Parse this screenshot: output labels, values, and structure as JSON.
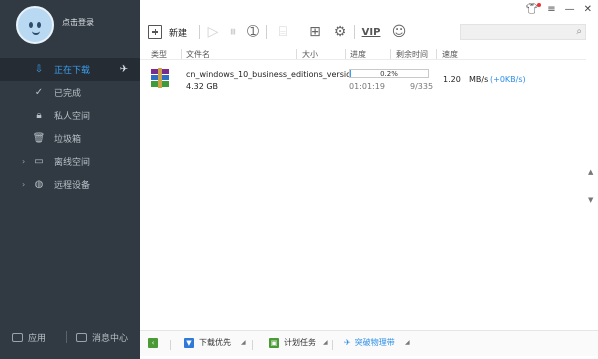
{
  "sidebar": {
    "login_text": "点击登录",
    "items": [
      {
        "label": "正在下载",
        "icon": "download-arrow-icon",
        "active": true
      },
      {
        "label": "已完成",
        "icon": "check-circle-icon"
      },
      {
        "label": "私人空间",
        "icon": "lock-icon"
      },
      {
        "label": "垃圾箱",
        "icon": "trash-icon"
      },
      {
        "label": "离线空间",
        "icon": "cloud-monitor-icon",
        "expandable": true
      },
      {
        "label": "远程设备",
        "icon": "globe-icon",
        "expandable": true
      }
    ],
    "app_label": "应用",
    "message_label": "消息中心"
  },
  "toolbar": {
    "new_label": "新建",
    "vip_label": "VIP"
  },
  "table": {
    "headers": [
      "类型",
      "文件名",
      "大小",
      "进度",
      "剩余时间",
      "速度"
    ],
    "rows": [
      {
        "filename": "cn_windows_10_business_editions_versio...",
        "size": "4.32 GB",
        "progress_percent": 0.2,
        "progress_label": "0.2%",
        "elapsed": "01:01:19",
        "pieces": "9/335",
        "speed": "1.20",
        "speed_unit": "MB/s",
        "upload_speed": "(+0KB/s)"
      }
    ]
  },
  "bottombar": {
    "items": [
      "下载优先",
      "计划任务",
      "突破物理带"
    ]
  },
  "colors": {
    "accent": "#3aa0f2",
    "sidebar_bg": "#313a42"
  }
}
